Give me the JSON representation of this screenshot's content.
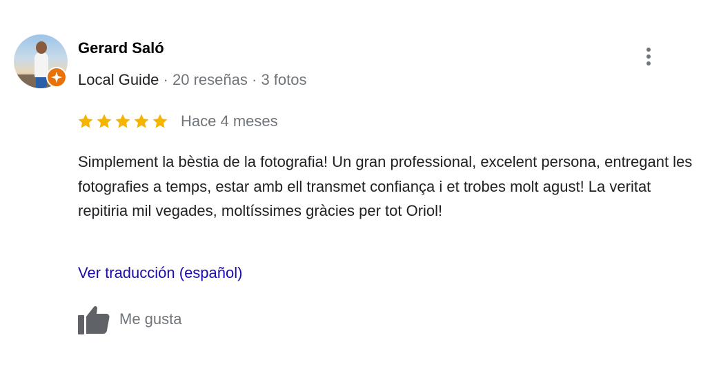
{
  "reviewer": {
    "name": "Gerard Saló",
    "role": "Local Guide",
    "separator": "·",
    "reviews_count": "20 reseñas",
    "photos_count": "3 fotos",
    "avatar": "user-photo-avatar",
    "badge_icon": "local-guide-star-icon"
  },
  "review": {
    "rating": 5,
    "rating_max": 5,
    "date": "Hace 4 meses",
    "text": "Simplement la bèstia de la fotografia! Un gran professional, excelent persona, entregant les fotografies a temps, estar amb ell transmet confiança i et trobes molt agust! La veritat repitiria mil vegades, moltíssimes gràcies per tot Oriol!",
    "translate_link": "Ver traducción (español)"
  },
  "actions": {
    "like_label": "Me gusta",
    "like_icon": "thumbs-up-icon",
    "more_icon": "more-vert-icon"
  },
  "colors": {
    "star": "#f4b400",
    "link": "#1a0dab",
    "secondary_text": "#70757a",
    "badge": "#e8710a",
    "icon": "#5f6368"
  }
}
